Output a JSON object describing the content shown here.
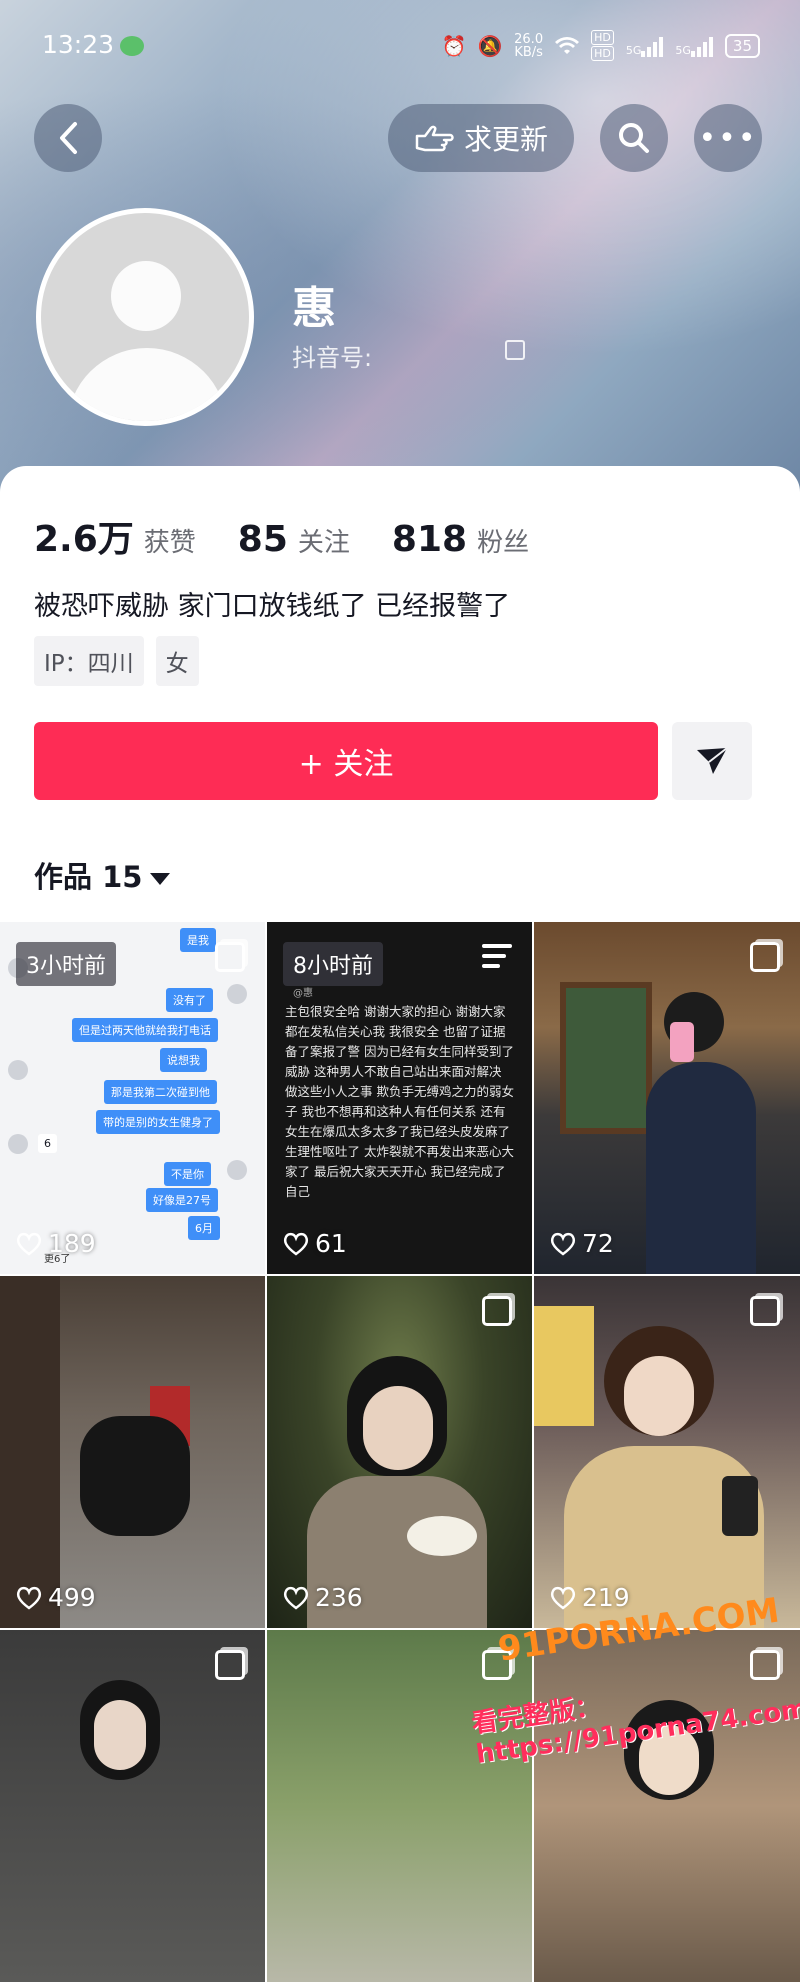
{
  "status_bar": {
    "time": "13:23",
    "net_speed_value": "26.0",
    "net_speed_unit": "KB/s",
    "hd1": "HD",
    "hd2": "HD",
    "sig1": "5G",
    "sig2": "5G",
    "battery": "35"
  },
  "header": {
    "request_update_label": "求更新"
  },
  "profile": {
    "nickname": "惠",
    "douyin_id_label": "抖音号:",
    "likes_count": "2.6万",
    "likes_label": "获赞",
    "following_count": "85",
    "following_label": "关注",
    "followers_count": "818",
    "followers_label": "粉丝",
    "bio": "被恐吓威胁 家门口放钱纸了 已经报警了",
    "tags": [
      "IP：四川",
      "女"
    ],
    "follow_button_label": "+ 关注"
  },
  "works": {
    "label": "作品 15"
  },
  "grid": [
    {
      "likes": "189",
      "time_ago": "3小时前",
      "type": "chat"
    },
    {
      "likes": "61",
      "time_ago": "8小时前",
      "type": "letter"
    },
    {
      "likes": "72",
      "type": "photo"
    },
    {
      "likes": "499",
      "type": "photo"
    },
    {
      "likes": "236",
      "type": "photo"
    },
    {
      "likes": "219",
      "type": "photo"
    },
    {
      "likes": "",
      "type": "photo"
    },
    {
      "likes": "",
      "type": "photo"
    },
    {
      "likes": "",
      "type": "photo"
    }
  ],
  "chat_bubbles": {
    "b1": "是我",
    "b2": "没有了",
    "b3": "但是过两天他就给我打电话",
    "b4": "说想我",
    "b5": "那是我第二次碰到他",
    "b6": "带的是别的女生健身了",
    "b7": "不是你",
    "b8": "好像是27号",
    "b9": "6月",
    "gray1": "6",
    "more": "更6了"
  },
  "letter": {
    "signature": "@惠",
    "body": "主包很安全哈 谢谢大家的担心 谢谢大家都在发私信关心我 我很安全 也留了证据备了案报了警 因为已经有女生同样受到了威胁 这种男人不敢自己站出来面对解决 做这些小人之事 欺负手无缚鸡之力的弱女子 我也不想再和这种人有任何关系 还有女生在爆瓜太多太多了我已经头皮发麻了 生理性呕吐了 太炸裂就不再发出来恶心大家了 最后祝大家天天开心 我已经完成了自己"
  },
  "watermark": {
    "line1": "91PORNA.COM",
    "line2": "看完整版：https://91porna74.com"
  },
  "colors": {
    "accent": "#fe2c55"
  }
}
